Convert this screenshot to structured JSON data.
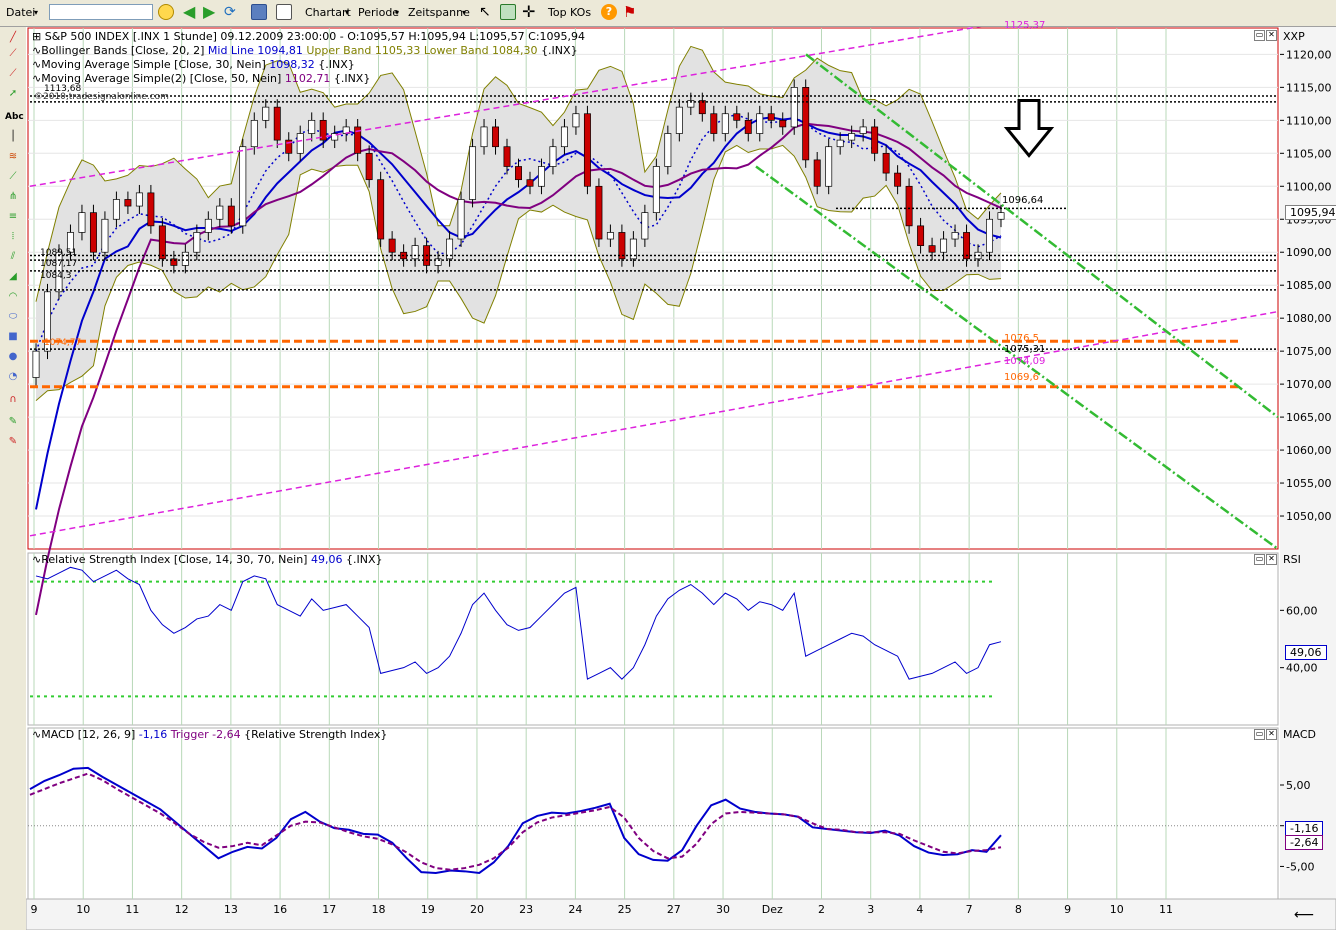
{
  "toolbar": {
    "file_menu": "Datei",
    "search_value": "",
    "chart_type": "Chartart",
    "period": "Periode",
    "timespan": "Zeitspanne",
    "top_kos": "Top KOs"
  },
  "main_panel": {
    "header": "S&P 500 INDEX [.INX  1 Stunde] 09.12.2009 23:00:00 - O:1095,57 H:1095,94 L:1095,57 C:1095,94",
    "bollinger": "Bollinger Bands [Close, 20, 2]",
    "bb_mid": "Mid Line 1094,81",
    "bb_upper": "Upper Band 1105,33",
    "bb_lower": "Lower Band 1084,30",
    "bb_sym": "{.INX}",
    "ma1": "Moving Average Simple [Close, 30, Nein]",
    "ma1_val": "1098,32",
    "ma1_sym": "{.INX}",
    "ma2": "Moving Average Simple(2) [Close, 50, Nein]",
    "ma2_val": "1102,71",
    "ma2_sym": "{.INX}",
    "watermark": "©2010,tradesignalonline.com",
    "axis_symbol": "XXP",
    "last_price": "1095,94",
    "line_labels": {
      "resist_top": "1113,68",
      "ann_1096": "1096,64",
      "ann_1076": "1076,5",
      "ann_1075": "1075,31",
      "ann_1074": "1074,09",
      "ann_1069": "1069,6",
      "ann_1074_left": "1074,77",
      "ann_1089": "1089,51",
      "ann_1087": "1087,17",
      "ann_1084": "1084,3",
      "ann_top": "1125,37"
    }
  },
  "rsi_panel": {
    "header": "Relative Strength Index [Close, 14, 30, 70, Nein]",
    "value": "49,06",
    "sym": "{.INX}",
    "axis_symbol": "RSI",
    "last_value": "49,06"
  },
  "macd_panel": {
    "header": "MACD [12, 26, 9]",
    "value": "-1,16",
    "trigger_label": "Trigger",
    "trigger_value": "-2,64",
    "sym": "{Relative Strength Index}",
    "axis_symbol": "MACD",
    "last_macd": "-1,16",
    "last_trigger": "-2,64"
  },
  "colors": {
    "up_candle": "#ffffff",
    "down_candle": "#cc0000",
    "ma1": "#0000cc",
    "ma2": "#800080",
    "bb": "#808000",
    "trend_green": "#33bb33",
    "trend_magenta": "#dd22dd",
    "support_orange": "#ff6600"
  },
  "chart_data": [
    {
      "type": "candlestick",
      "title": "S&P 500 INDEX [.INX 1 Stunde]",
      "ylim": [
        1045,
        1124
      ],
      "y_ticks": [
        "1120,00",
        "1115,00",
        "1110,00",
        "1105,00",
        "1100,00",
        "1095,00",
        "1090,00",
        "1085,00",
        "1080,00",
        "1075,00",
        "1070,00",
        "1065,00",
        "1060,00",
        "1055,00",
        "1050,00"
      ],
      "x_ticks": [
        "9",
        "10",
        "11",
        "12",
        "13",
        "16",
        "17",
        "18",
        "19",
        "20",
        "23",
        "24",
        "25",
        "27",
        "30",
        "Dez",
        "2",
        "3",
        "4",
        "7",
        "8",
        "9",
        "10",
        "11"
      ],
      "close_series": [
        1075,
        1084,
        1090,
        1093,
        1096,
        1090,
        1095,
        1098,
        1097,
        1099,
        1094,
        1089,
        1088,
        1090,
        1093,
        1095,
        1097,
        1094,
        1106,
        1110,
        1112,
        1107,
        1105,
        1108,
        1110,
        1107,
        1108,
        1109,
        1105,
        1101,
        1092,
        1090,
        1089,
        1091,
        1088,
        1089,
        1092,
        1098,
        1106,
        1109,
        1106,
        1103,
        1101,
        1100,
        1103,
        1106,
        1109,
        1111,
        1100,
        1092,
        1093,
        1089,
        1092,
        1096,
        1103,
        1108,
        1112,
        1113,
        1111,
        1108,
        1111,
        1110,
        1108,
        1111,
        1110,
        1109,
        1115,
        1104,
        1100,
        1106,
        1107,
        1108,
        1109,
        1105,
        1102,
        1100,
        1094,
        1091,
        1090,
        1092,
        1093,
        1089,
        1090,
        1095,
        1096
      ],
      "horizontal_levels": [
        1113.68,
        1112.8,
        1096.64,
        1089.51,
        1088.8,
        1087.17,
        1084.3,
        1076.5,
        1075.31,
        1069.6
      ],
      "series": [
        {
          "name": "Mid Line",
          "last": 1094.81
        },
        {
          "name": "Upper Band",
          "last": 1105.33
        },
        {
          "name": "Lower Band",
          "last": 1084.3
        },
        {
          "name": "Moving Average Simple",
          "last": 1098.32
        },
        {
          "name": "Moving Average Simple(2)",
          "last": 1102.71
        }
      ]
    },
    {
      "type": "line",
      "title": "Relative Strength Index [Close, 14, 30, 70, Nein]",
      "ylim": [
        20,
        80
      ],
      "y_ticks": [
        "60,00",
        "40,00"
      ],
      "levels": [
        30,
        70
      ],
      "values": [
        72,
        71,
        73,
        75,
        74,
        70,
        72,
        74,
        71,
        69,
        60,
        55,
        52,
        54,
        57,
        58,
        62,
        60,
        70,
        72,
        71,
        62,
        60,
        58,
        64,
        60,
        61,
        62,
        58,
        54,
        38,
        39,
        40,
        42,
        38,
        40,
        44,
        52,
        62,
        66,
        60,
        55,
        53,
        54,
        58,
        62,
        66,
        68,
        36,
        38,
        40,
        36,
        40,
        48,
        58,
        64,
        67,
        69,
        66,
        62,
        66,
        64,
        60,
        63,
        62,
        60,
        66,
        44,
        46,
        48,
        50,
        52,
        51,
        48,
        46,
        44,
        36,
        37,
        38,
        40,
        42,
        38,
        40,
        48,
        49.06
      ]
    },
    {
      "type": "line",
      "title": "MACD [12, 26, 9]",
      "ylim": [
        -9,
        12
      ],
      "y_ticks": [
        "5,00",
        "0,00",
        "-5,00"
      ],
      "series": [
        {
          "name": "MACD",
          "last": -1.16,
          "values": [
            4.5,
            5.5,
            6.2,
            7,
            7.1,
            6,
            5,
            4,
            3,
            2,
            0.5,
            -1,
            -2.5,
            -4,
            -3.2,
            -2.6,
            -2.8,
            -1.5,
            0.8,
            1.7,
            0.5,
            -0.3,
            -0.5,
            -1,
            -1.1,
            -2.1,
            -4,
            -5.7,
            -5.8,
            -5.5,
            -5.6,
            -5.8,
            -4.5,
            -2.5,
            0.3,
            1.2,
            1.6,
            1.5,
            1.8,
            2.2,
            2.7,
            -1.5,
            -3.5,
            -4.2,
            -4.3,
            -3,
            0,
            2.5,
            3.2,
            2.1,
            1.7,
            1.5,
            1.4,
            1.1,
            -0.2,
            -0.4,
            -0.6,
            -0.8,
            -0.9,
            -0.6,
            -1.2,
            -2.5,
            -3.3,
            -3.6,
            -3.5,
            -3,
            -3.2,
            -1.16
          ]
        },
        {
          "name": "Trigger",
          "last": -2.64,
          "values": [
            3.8,
            4.5,
            5.2,
            5.8,
            6.4,
            5.6,
            4.5,
            3.5,
            2.5,
            1.5,
            0.3,
            -1,
            -2,
            -2.7,
            -2.5,
            -2.1,
            -2.4,
            -1.2,
            0,
            0.5,
            0.4,
            -0.2,
            -0.8,
            -1.3,
            -1.6,
            -2.3,
            -3.3,
            -4.5,
            -5.2,
            -5.4,
            -5.2,
            -4.8,
            -4,
            -2.7,
            -0.8,
            0.4,
            1,
            1.3,
            1.6,
            1.9,
            2.3,
            1,
            -1.5,
            -3.1,
            -4,
            -3.8,
            -2.2,
            0.2,
            1.5,
            1.7,
            1.6,
            1.5,
            1.4,
            1.1,
            0.3,
            -0.4,
            -0.5,
            -0.8,
            -0.8,
            -0.8,
            -1,
            -1.8,
            -2.5,
            -3.2,
            -3.4,
            -3.1,
            -3,
            -2.64
          ]
        }
      ]
    }
  ]
}
